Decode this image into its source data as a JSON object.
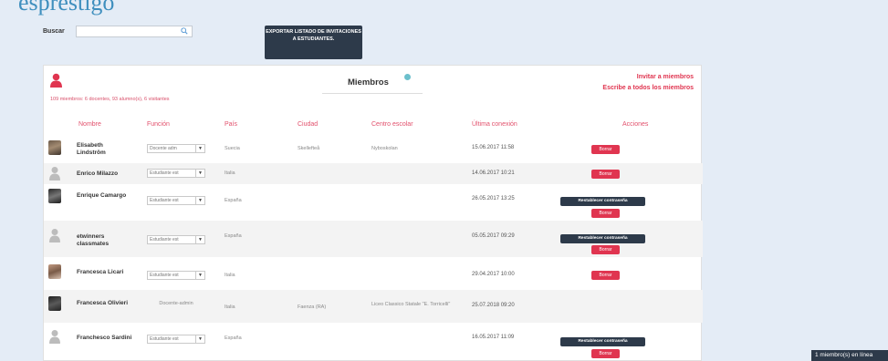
{
  "page": {
    "title_fragment": "esprestigo",
    "search_label": "Buscar",
    "search_value": "",
    "export_label": "EXPORTAR LISTADO DE INVITACIONES A ESTUDIANTES."
  },
  "panel": {
    "title": "Miembros",
    "summary": "109 miembros: 6 docentes, 93 alumno(s), 6 visitantes",
    "invite_link": "Invitar a miembros",
    "write_link": "Escribe a todos los miembros"
  },
  "columns": [
    "Nombre",
    "Función",
    "País",
    "Ciudad",
    "Centro escolar",
    "Última conexión",
    "Acciones"
  ],
  "rows": [
    {
      "name": "Elisabeth Lindström",
      "role": "Docente adm",
      "role_type": "select",
      "country": "Suecia",
      "city": "Skellefteå",
      "school": "Nyboskolan",
      "last": "15.06.2017 11:58",
      "reset": "",
      "delete": "Borrar",
      "avatar": "photo-icon"
    },
    {
      "name": "Enrico Milazzo",
      "role": "Estudiante est",
      "role_type": "select",
      "country": "Italia",
      "city": "",
      "school": "",
      "last": "14.06.2017 10:21",
      "reset": "",
      "delete": "Borrar",
      "avatar": "user-placeholder-icon"
    },
    {
      "name": "Enrique Camargo",
      "role": "Estudiante est",
      "role_type": "select",
      "country": "España",
      "city": "",
      "school": "",
      "last": "26.05.2017 13:25",
      "reset": "Restablecer contraseña",
      "delete": "Borrar",
      "avatar": "photo-icon"
    },
    {
      "name": "etwinners classmates",
      "role": "Estudiante est",
      "role_type": "select",
      "country": "España",
      "city": "",
      "school": "",
      "last": "05.05.2017 09:29",
      "reset": "Restablecer contraseña",
      "delete": "Borrar",
      "avatar": "user-placeholder-icon"
    },
    {
      "name": "Francesca Licari",
      "role": "Estudiante est",
      "role_type": "select",
      "country": "Italia",
      "city": "",
      "school": "",
      "last": "29.04.2017 10:00",
      "reset": "",
      "delete": "Borrar",
      "avatar": "photo-icon"
    },
    {
      "name": "Francesca Olivieri",
      "role": "Docente-admin",
      "role_type": "static",
      "country": "Italia",
      "city": "Faenza (RA)",
      "school": "Liceo Classico Statale \"E. Torricelli\"",
      "last": "25.07.2018 09:20",
      "reset": "",
      "delete": "",
      "avatar": "photo-icon"
    },
    {
      "name": "Franchesco Sardini",
      "role": "Estudiante est",
      "role_type": "select",
      "country": "España",
      "city": "",
      "school": "",
      "last": "16.05.2017 11:09",
      "reset": "Restablecer contraseña",
      "delete": "Borrar",
      "avatar": "user-placeholder-icon"
    }
  ],
  "toast": "1 miembro(s) en línea",
  "colors": {
    "accent": "#e03550",
    "dark": "#2d3a4a",
    "header_text": "#e2506c",
    "background": "#e4ecf6"
  }
}
